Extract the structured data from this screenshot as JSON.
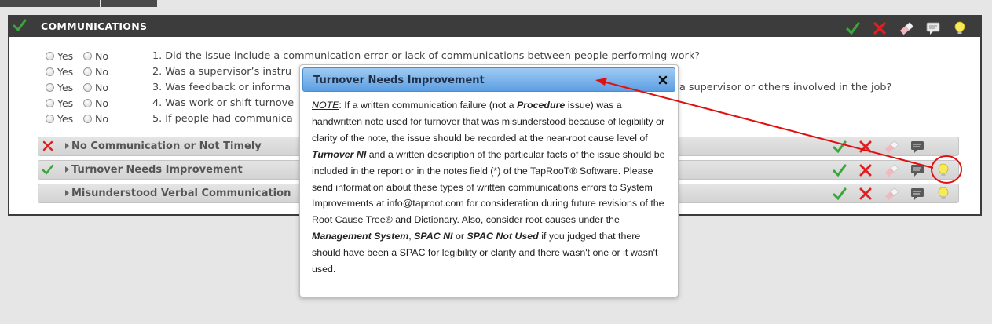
{
  "section": {
    "title": "COMMUNICATIONS"
  },
  "answer_options": {
    "yes": "Yes",
    "no": "No"
  },
  "questions": [
    "1. Did the issue include a communication error or lack of communications between people performing work?",
    "2. Was a supervisor’s instru",
    "3. Was feedback or informa",
    "4. Was work or shift turnove",
    "5. If people had communica"
  ],
  "question_tail": "a supervisor or others involved in the job?",
  "causes": [
    {
      "label": "No Communication or Not Timely",
      "status": "x-icon"
    },
    {
      "label": "Turnover Needs Improvement",
      "status": "check-icon"
    },
    {
      "label": "Misunderstood Verbal Communication",
      "status": "none"
    }
  ],
  "dialog": {
    "title": "Turnover Needs Improvement",
    "close_glyph": "✖",
    "body": [
      {
        "t": "NOTE",
        "s": "u"
      },
      {
        "t": ": If a written communication failure (not a "
      },
      {
        "t": "Procedure",
        "s": "bi"
      },
      {
        "t": " issue) was a handwritten note used for turnover that was misunderstood because of legibility or clarity of the note, the issue should be recorded at the near-root cause level of "
      },
      {
        "t": "Turnover NI",
        "s": "bi"
      },
      {
        "t": " and a written description of the particular facts of the issue should be included in the report or in the notes field (*) of the TapRooT® Software. Please send information about these types of written communications errors to System Improvements at info@taproot.com for consideration during future revisions of the Root Cause Tree® and Dictionary. Also, consider root causes under the "
      },
      {
        "t": "Management System",
        "s": "bi"
      },
      {
        "t": ", "
      },
      {
        "t": "SPAC NI",
        "s": "bi"
      },
      {
        "t": " or "
      },
      {
        "t": "SPAC Not Used",
        "s": "bi"
      },
      {
        "t": " if you judged that there should have been a SPAC for legibility or clarity and there wasn't one or it wasn't used."
      }
    ]
  },
  "colors": {
    "check": "#3aa53a",
    "x": "#e02020",
    "header_bg": "#3c3c3c",
    "annotation": "#e01010",
    "dialog_title_bg": "#5c9ee3"
  },
  "icons": [
    "check-icon",
    "x-icon",
    "eraser-icon",
    "comment-icon",
    "lightbulb-icon"
  ]
}
